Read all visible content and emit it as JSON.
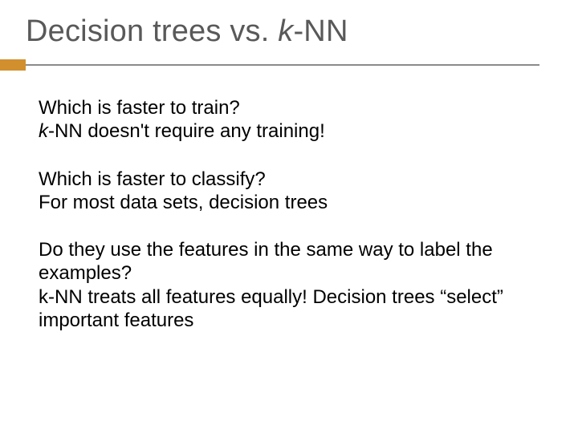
{
  "title": {
    "pre": "Decision trees vs. ",
    "ital": "k",
    "post": "-NN"
  },
  "b1": {
    "q": "Which is faster to train?",
    "a_ital": "k",
    "a_rest": "-NN doesn't require any training!"
  },
  "b2": {
    "q": "Which is faster to classify?",
    "a": "For most data sets, decision trees"
  },
  "b3": {
    "q": "Do they use the features in the same way to label the examples?",
    "a": "k-NN treats all features equally!  Decision trees “select” important features"
  }
}
